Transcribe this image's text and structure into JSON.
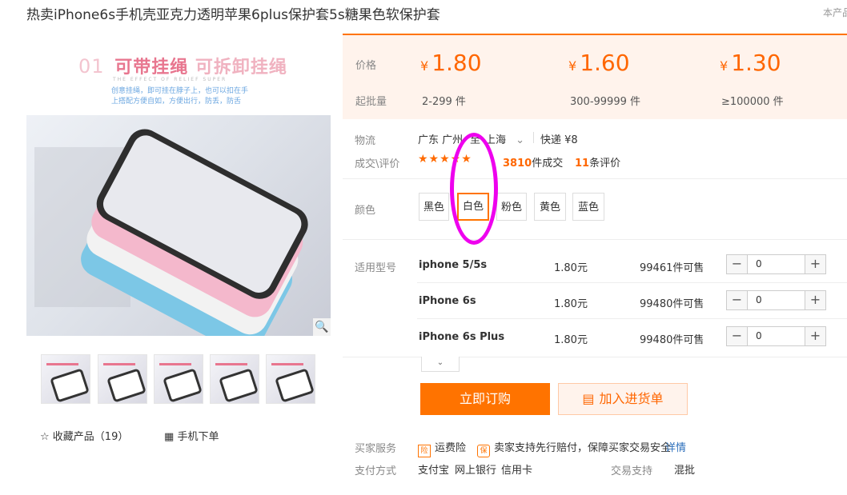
{
  "title": "热卖iPhone6s手机壳亚克力透明苹果6plus保护套5s糖果色软保护套",
  "corner_text": "本产品",
  "image": {
    "promo_number": "01",
    "promo_line1": "可带挂绳",
    "promo_line1b": "可拆卸挂绳",
    "promo_line2": "THE EFFECT OF RELIEF SUPER",
    "promo_line3a": "创意挂绳，即可挂在脖子上，也可以扣在手",
    "promo_line3b": "上搭配方便自如，方便出行，防丢，防舌"
  },
  "favorite": {
    "label": "收藏产品（19）"
  },
  "mobile_order": {
    "label": "手机下单"
  },
  "price_box": {
    "price_label": "价格",
    "moq_label": "起批量",
    "tiers": [
      {
        "currency": "¥",
        "price": "1.80",
        "range": "2-299 件"
      },
      {
        "currency": "¥",
        "price": "1.60",
        "range": "300-99999 件"
      },
      {
        "currency": "¥",
        "price": "1.30",
        "range": "≥100000 件"
      }
    ]
  },
  "logistics": {
    "label": "物流",
    "from": "广东 广州",
    "to_prefix": "至",
    "to": "上海",
    "express": "快递 ¥8"
  },
  "deals": {
    "label": "成交\\评价",
    "stars": "★★★★★",
    "rating": 4.5,
    "count": "3810",
    "count_unit": "件成交",
    "reviews": "11",
    "reviews_unit": "条评价"
  },
  "colors": {
    "label": "颜色",
    "options": [
      "黑色",
      "白色",
      "粉色",
      "黄色",
      "蓝色"
    ],
    "selected": "白色"
  },
  "models": {
    "label": "适用型号",
    "rows": [
      {
        "name": "iphone 5/5s",
        "price": "1.80元",
        "stock": "99461件可售",
        "qty": "0"
      },
      {
        "name": "iPhone 6s",
        "price": "1.80元",
        "stock": "99480件可售",
        "qty": "0"
      },
      {
        "name": "iPhone 6s Plus",
        "price": "1.80元",
        "stock": "99480件可售",
        "qty": "0"
      }
    ]
  },
  "buttons": {
    "buy_now": "立即订购",
    "add_cart": "加入进货单"
  },
  "services": {
    "label": "买家服务",
    "item1": "运费险",
    "item2": "卖家支持先行赔付，保障买家交易安全",
    "detail_link": "详情"
  },
  "payment": {
    "label": "支付方式",
    "methods": [
      "支付宝",
      "网上银行",
      "信用卡"
    ],
    "trade_label": "交易支持",
    "trade_value": "混批"
  },
  "colors_theme": {
    "accent": "#ff7300",
    "price": "#ff6600",
    "annotation": "#ee00ee"
  }
}
